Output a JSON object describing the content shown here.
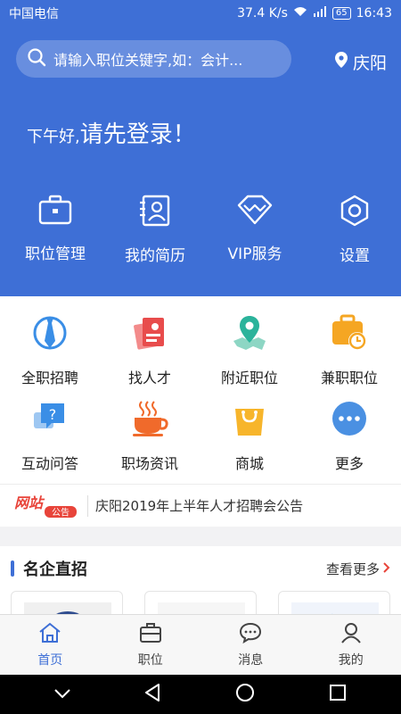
{
  "status_bar": {
    "carrier": "中国电信",
    "speed": "37.4 K/s",
    "battery": "65",
    "time": "16:43"
  },
  "search": {
    "placeholder": "请输入职位关键字,如：会计..."
  },
  "location": {
    "city": "庆阳"
  },
  "greeting": {
    "prefix": "下午好,",
    "message": "请先登录！"
  },
  "hero_actions": [
    {
      "label": "职位管理",
      "icon": "briefcase-icon"
    },
    {
      "label": "我的简历",
      "icon": "resume-icon"
    },
    {
      "label": "VIP服务",
      "icon": "diamond-icon"
    },
    {
      "label": "设置",
      "icon": "gear-icon"
    }
  ],
  "grid": {
    "row1": [
      {
        "label": "全职招聘",
        "icon": "tie-icon",
        "color": "#3a8ee6"
      },
      {
        "label": "找人才",
        "icon": "talent-card-icon",
        "color": "#e84c4c"
      },
      {
        "label": "附近职位",
        "icon": "map-pin-icon",
        "color": "#2bb39b"
      },
      {
        "label": "兼职职位",
        "icon": "part-time-icon",
        "color": "#f5a623"
      }
    ],
    "row2": [
      {
        "label": "互动问答",
        "icon": "qa-icon",
        "color": "#3a8ee6"
      },
      {
        "label": "职场资讯",
        "icon": "coffee-icon",
        "color": "#f06a2b"
      },
      {
        "label": "商城",
        "icon": "shopping-bag-icon",
        "color": "#f7b52b"
      },
      {
        "label": "更多",
        "icon": "more-icon",
        "color": "#4a90e2"
      }
    ]
  },
  "notice": {
    "tag_top": "网站",
    "tag_bottom": "公告",
    "text": "庆阳2019年上半年人才招聘会公告"
  },
  "companies": {
    "title": "名企直招",
    "more": "查看更多"
  },
  "tabbar": [
    {
      "label": "首页",
      "icon": "home-icon",
      "active": true
    },
    {
      "label": "职位",
      "icon": "briefcase-icon",
      "active": false
    },
    {
      "label": "消息",
      "icon": "chat-icon",
      "active": false
    },
    {
      "label": "我的",
      "icon": "person-icon",
      "active": false
    }
  ],
  "colors": {
    "primary": "#3e6fd6",
    "notice_red": "#e8443a"
  }
}
